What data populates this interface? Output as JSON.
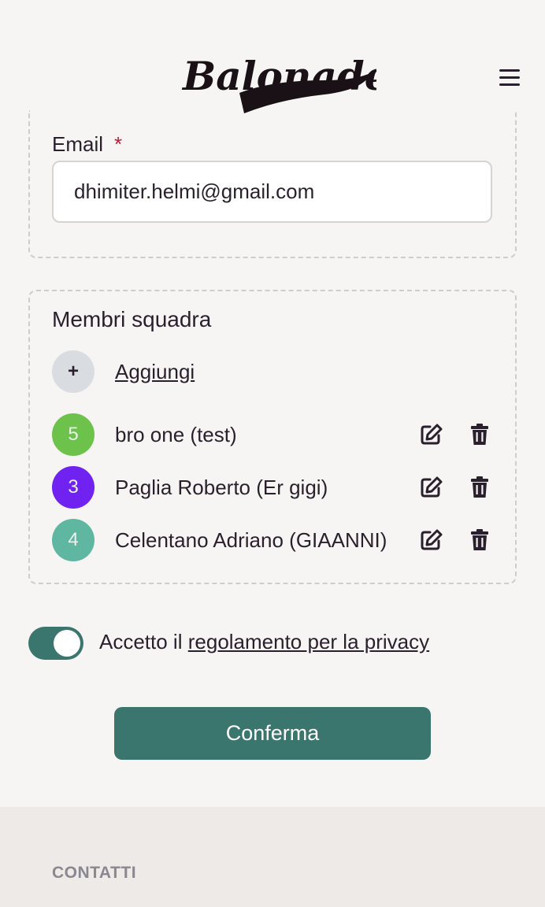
{
  "header": {
    "logo_text": "Balonade",
    "menu_icon": "hamburger-menu-icon"
  },
  "email_section": {
    "label": "Email",
    "required_mark": "*",
    "value": "dhimiter.helmi@gmail.com"
  },
  "members_section": {
    "title": "Membri squadra",
    "add_label": "Aggiungi",
    "add_icon_glyph": "+",
    "members": [
      {
        "number": "5",
        "name": "bro one (test)",
        "color": "#6cc24a"
      },
      {
        "number": "3",
        "name": "Paglia Roberto (Er gigi)",
        "color": "#6f22f0"
      },
      {
        "number": "4",
        "name": "Celentano Adriano (GIAANNI)",
        "color": "#5fb7a2"
      }
    ],
    "edit_icon": "edit-icon",
    "delete_icon": "trash-icon"
  },
  "privacy": {
    "prefix": "Accetto il",
    "link_text": "regolamento per la privacy",
    "accepted": true
  },
  "confirm_label": "Conferma",
  "footer": {
    "title": "CONTATTI"
  },
  "colors": {
    "accent": "#3a766d",
    "background": "#f7f5f3",
    "footer_background": "#edeae7",
    "required": "#b0203a",
    "text": "#2a1f2d"
  }
}
